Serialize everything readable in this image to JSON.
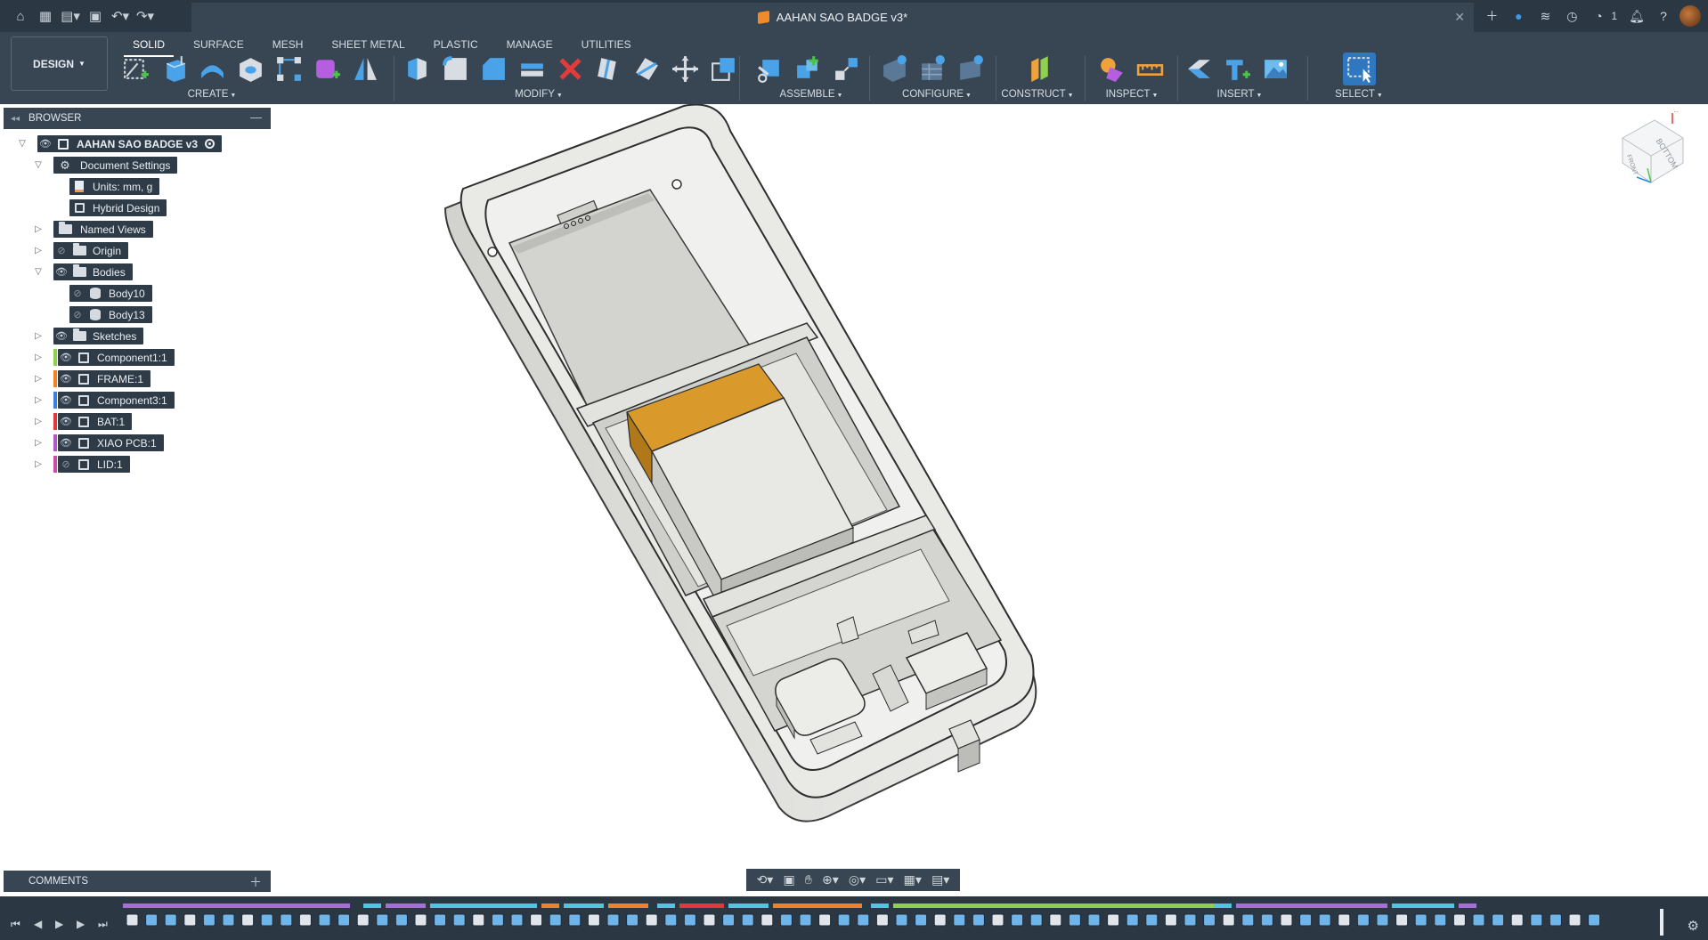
{
  "window": {
    "document_title": "AAHAN SAO BADGE v3*",
    "notification_count": "1"
  },
  "toolbar": {
    "workspace": "DESIGN",
    "tabs": [
      {
        "label": "SOLID",
        "active": true
      },
      {
        "label": "SURFACE",
        "active": false
      },
      {
        "label": "MESH",
        "active": false
      },
      {
        "label": "SHEET METAL",
        "active": false
      },
      {
        "label": "PLASTIC",
        "active": false
      },
      {
        "label": "MANAGE",
        "active": false
      },
      {
        "label": "UTILITIES",
        "active": false
      }
    ],
    "groups": {
      "create": "CREATE",
      "modify": "MODIFY",
      "assemble": "ASSEMBLE",
      "configure": "CONFIGURE",
      "construct": "CONSTRUCT",
      "inspect": "INSPECT",
      "insert": "INSERT",
      "select": "SELECT"
    }
  },
  "browser": {
    "title": "BROWSER",
    "root": "AAHAN SAO BADGE v3",
    "items": [
      {
        "label": "Document Settings"
      },
      {
        "label": "Units: mm, g"
      },
      {
        "label": "Hybrid Design"
      },
      {
        "label": "Named Views"
      },
      {
        "label": "Origin"
      },
      {
        "label": "Bodies"
      },
      {
        "label": "Body10"
      },
      {
        "label": "Body13"
      },
      {
        "label": "Sketches"
      },
      {
        "label": "Component1:1",
        "color": "#8fd14f"
      },
      {
        "label": "FRAME:1",
        "color": "#f0822a"
      },
      {
        "label": "Component3:1",
        "color": "#3f7fe0"
      },
      {
        "label": "BAT:1",
        "color": "#e0383c"
      },
      {
        "label": "XIAO PCB:1",
        "color": "#b05ac8"
      },
      {
        "label": "LID:1",
        "color": "#c84fa8"
      }
    ]
  },
  "comments": {
    "title": "COMMENTS"
  },
  "viewcube": {
    "face": "BOTTOM",
    "side": "FRONT"
  },
  "colors": {
    "titlebar_bg": "#2b3844",
    "toolbar_bg": "#384654",
    "panel_bg": "#384654",
    "accent": "#2a8bd6",
    "battery": "#d99a2b",
    "model_light": "#e6e6e3",
    "model_shadow": "#a9a9a5"
  }
}
